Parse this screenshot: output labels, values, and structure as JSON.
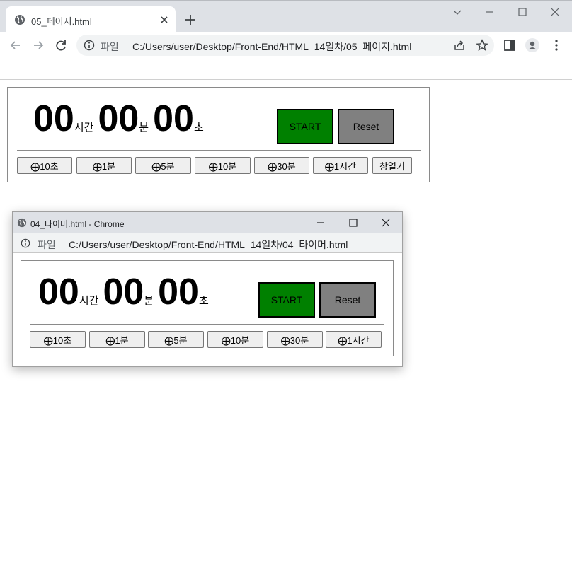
{
  "browser": {
    "tab_title": "05_페이지.html",
    "address_scheme": "파일",
    "address_url": "C:/Users/user/Desktop/Front-End/HTML_14일차/05_페이지.html"
  },
  "main_timer": {
    "hours": "00",
    "hours_unit": "시간",
    "minutes": "00",
    "minutes_unit": "분",
    "seconds": "00",
    "seconds_unit": "초",
    "start_label": "START",
    "reset_label": "Reset",
    "add_buttons": [
      "⨁10초",
      "⨁1분",
      "⨁5분",
      "⨁10분",
      "⨁30분",
      "⨁1시간"
    ],
    "open_window_label": "창열기"
  },
  "popup": {
    "window_title": "04_타이머.html - Chrome",
    "address_scheme": "파일",
    "address_url": "C:/Users/user/Desktop/Front-End/HTML_14일차/04_타이머.html",
    "timer": {
      "hours": "00",
      "hours_unit": "시간",
      "minutes": "00",
      "minutes_unit": "분",
      "seconds": "00",
      "seconds_unit": "초",
      "start_label": "START",
      "reset_label": "Reset",
      "add_buttons": [
        "⨁10초",
        "⨁1분",
        "⨁5분",
        "⨁10분",
        "⨁30분",
        "⨁1시간"
      ]
    }
  },
  "colors": {
    "start_button": "#008000",
    "reset_button": "#808080",
    "chrome_frame": "#dee1e6"
  }
}
